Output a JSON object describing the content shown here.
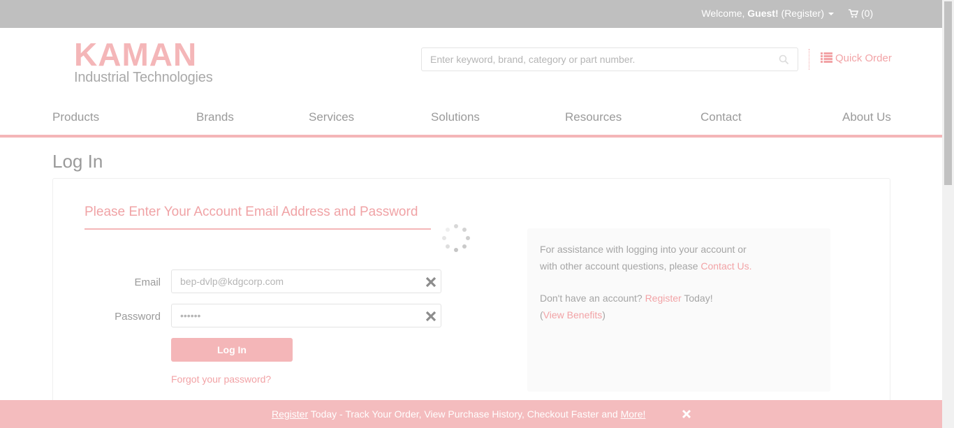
{
  "topbar": {
    "welcome_prefix": "Welcome, ",
    "guest": "Guest!",
    "register": "(Register)",
    "cart_count": "(0)"
  },
  "logo": {
    "brand": "KAMAN",
    "tagline": "Industrial Technologies"
  },
  "search": {
    "placeholder": "Enter keyword, brand, category or part number."
  },
  "quick_order": {
    "label": "Quick Order"
  },
  "nav": {
    "items": [
      {
        "label": "Products"
      },
      {
        "label": "Brands"
      },
      {
        "label": "Services"
      },
      {
        "label": "Solutions"
      },
      {
        "label": "Resources"
      },
      {
        "label": "Contact"
      },
      {
        "label": "About Us"
      }
    ]
  },
  "page": {
    "title": "Log In",
    "heading": "Please Enter Your Account Email Address and Password"
  },
  "form": {
    "email_label": "Email",
    "email_value": "bep-dvlp@kdgcorp.com",
    "password_label": "Password",
    "password_value": "••••••",
    "login_label": "Log In",
    "forgot_label": "Forgot your password?"
  },
  "assist": {
    "line1": "For assistance with logging into your account or",
    "line2_prefix": "with other account questions, please ",
    "contact_link": "Contact Us.",
    "no_account": "Don't have an account? ",
    "register_link": "Register",
    "today": " Today!",
    "paren_open": "(",
    "benefits_link": "View Benefits",
    "paren_close": ")"
  },
  "banner": {
    "register_link": "Register",
    "middle": " Today - Track Your Order, View Purchase History, Checkout Faster and ",
    "more_link": "More!"
  },
  "colors": {
    "brand_pink": "#f4b6b8",
    "link_pink": "#f2a3a6",
    "topbar_gray": "#bfbfbf"
  }
}
